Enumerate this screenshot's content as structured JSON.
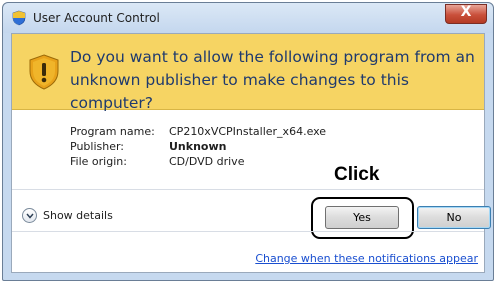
{
  "window": {
    "title": "User Account Control",
    "close_label": "X"
  },
  "prompt": {
    "question": "Do you want to allow the following program from an unknown publisher to make changes to this computer?"
  },
  "details": {
    "program_name_label": "Program name:",
    "program_name": "CP210xVCPInstaller_x64.exe",
    "publisher_label": "Publisher:",
    "publisher": "Unknown",
    "file_origin_label": "File origin:",
    "file_origin": "CD/DVD drive"
  },
  "annotation": {
    "click_label": "Click"
  },
  "footer": {
    "show_details_label": "Show details",
    "yes_label": "Yes",
    "no_label": "No",
    "notifications_link": "Change when these notifications appear"
  },
  "icons": {
    "title": "uac-shield-icon",
    "warning": "warning-shield-icon",
    "expand": "chevron-down-icon"
  },
  "colors": {
    "banner": "#f6d463",
    "question_text": "#1f3a6e",
    "link": "#1a4fd0",
    "close_button": "#c9503b"
  }
}
